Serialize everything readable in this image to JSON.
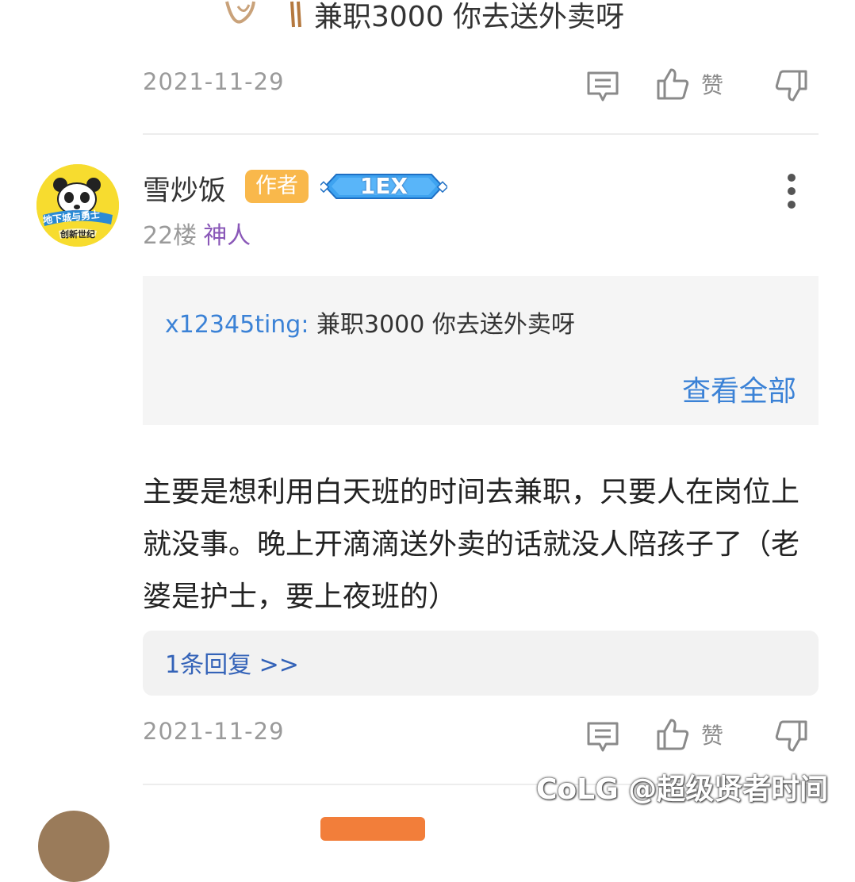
{
  "previous_comment": {
    "text": "兼职3000 你去送外卖呀",
    "date": "2021-11-29",
    "like_label": "赞"
  },
  "comment": {
    "username": "雪炒饭",
    "author_badge": "作者",
    "level_badge": "1EX",
    "floor": "22楼",
    "floor_tag": "神人",
    "quote": {
      "user": "x12345ting:",
      "text": "兼职3000 你去送外卖呀",
      "view_all": "查看全部"
    },
    "body": "主要是想利用白天班的时间去兼职，只要人在岗位上就没事。晚上开滴滴送外卖的话就没人陪孩子了（老婆是护士，要上夜班的）",
    "replies": "1条回复 >>",
    "date": "2021-11-29",
    "like_label": "赞",
    "avatar_caption_top": "地下城与勇士",
    "avatar_caption_bottom": "创新世纪"
  },
  "watermark": "CoLG @超级贤者时间",
  "colors": {
    "link_blue": "#3b82d6",
    "author_badge": "#f9b84b",
    "floor_tag_purple": "#8a58b8"
  }
}
